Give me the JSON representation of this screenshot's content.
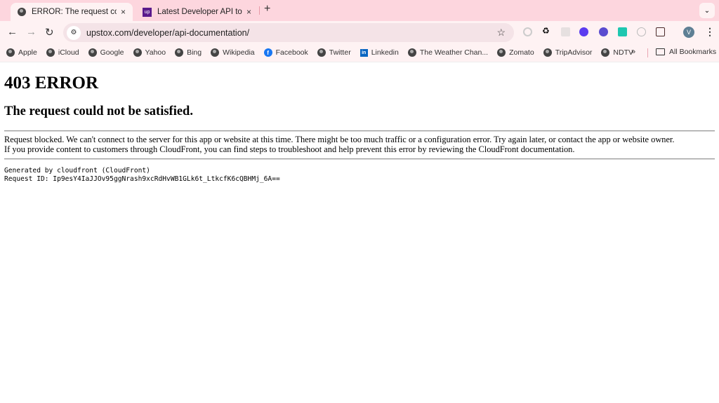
{
  "tabs": [
    {
      "title": "ERROR: The request could not be satisfied",
      "close": "×"
    },
    {
      "title": "Latest Developer API topics - Upstox Community",
      "close": "×",
      "favicon_text": "up"
    }
  ],
  "new_tab": "+",
  "tab_menu": "⌄",
  "toolbar": {
    "back": "←",
    "forward": "→",
    "reload": "↻",
    "url": "upstox.com/developer/api-documentation/",
    "star": "☆",
    "profile_initial": "V",
    "menu": "⋮"
  },
  "extensions": [
    "loader-icon",
    "recycle-icon",
    "grid-icon",
    "sun-icon",
    "wave-icon",
    "bracket-icon",
    "compass-icon",
    "puzzle-icon"
  ],
  "bookmarks": [
    "Apple",
    "iCloud",
    "Google",
    "Yahoo",
    "Bing",
    "Wikipedia",
    "Facebook",
    "Twitter",
    "Linkedin",
    "The Weather Chan...",
    "Zomato",
    "TripAdvisor",
    "NDTV"
  ],
  "bookmarks_more": "»",
  "all_bookmarks": "All Bookmarks",
  "page": {
    "h1": "403 ERROR",
    "h2": "The request could not be satisfied.",
    "p1": "Request blocked. We can't connect to the server for this app or website at this time. There might be too much traffic or a configuration error. Try again later, or contact the app or website owner.",
    "p2": "If you provide content to customers through CloudFront, you can find steps to troubleshoot and help prevent this error by reviewing the CloudFront documentation.",
    "generated": "Generated by cloudfront (CloudFront)",
    "request_id": "Request ID: Ip9esY4IaJJOv95ggNrash9xcRdHvWB1GLk6t_LtkcfK6cQBHMj_6A=="
  }
}
